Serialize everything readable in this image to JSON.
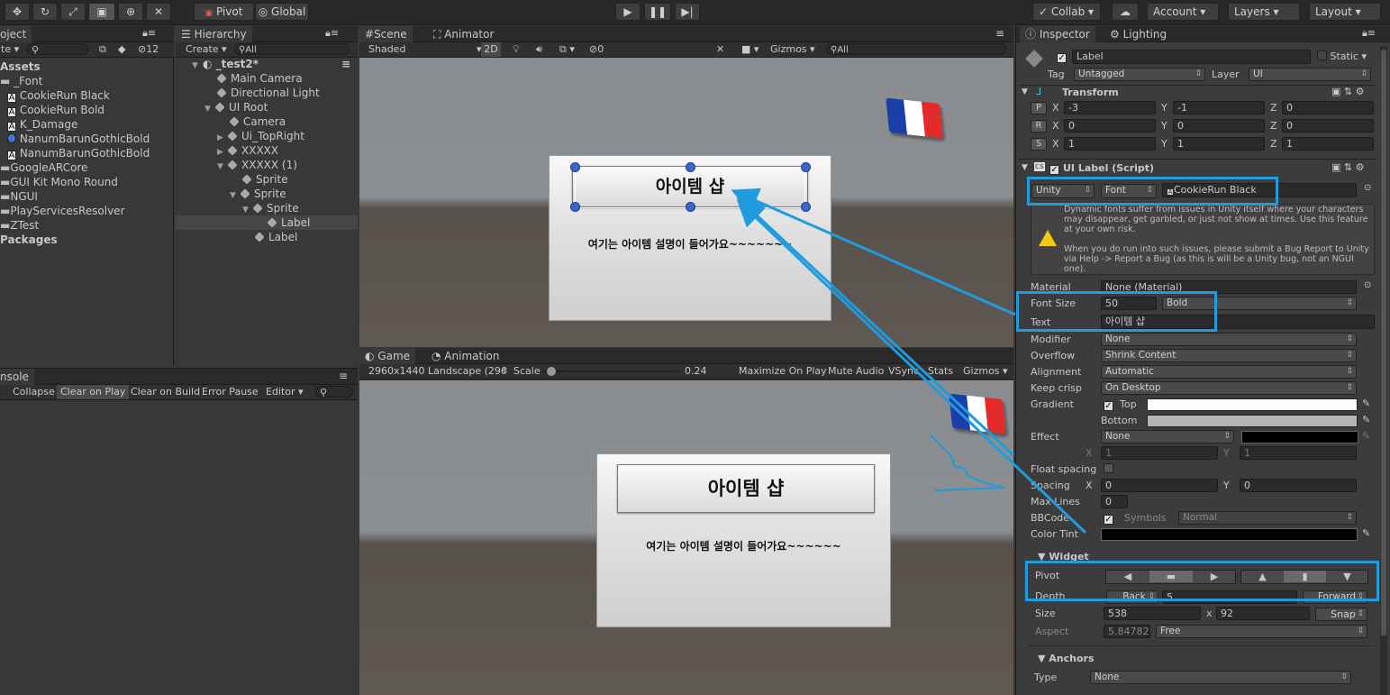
{
  "toolbar": {
    "pivot": "Pivot",
    "global": "Global",
    "collab": "Collab",
    "account": "Account",
    "layers": "Layers",
    "layout": "Layout"
  },
  "project": {
    "tab": "oject",
    "visible_count": "12",
    "assets": "Assets",
    "items": [
      "_Font",
      "CookieRun Black",
      "CookieRun Bold",
      "K_Damage",
      "NanumBarunGothicBold",
      "NanumBarunGothicBold",
      "GoogleARCore",
      "GUI Kit Mono Round",
      "NGUI",
      "PlayServicesResolver",
      "ZTest"
    ],
    "packages": "Packages"
  },
  "hierarchy": {
    "tab": "Hierarchy",
    "create": "Create",
    "search_placeholder": "All",
    "scene": "_test2*",
    "items": [
      "Main Camera",
      "Directional Light",
      "UI Root",
      "Camera",
      "Ui_TopRight",
      "XXXXX",
      "XXXXX (1)",
      "Sprite",
      "Sprite",
      "Sprite",
      "Label",
      "Label"
    ]
  },
  "console": {
    "tab": "nsole",
    "collapse": "Collapse",
    "clear_on_play": "Clear on Play",
    "clear_on_build": "Clear on Build",
    "error_pause": "Error Pause",
    "editor": "Editor"
  },
  "scene": {
    "tab": "Scene",
    "tab2": "Animator",
    "shaded": "Shaded",
    "mode2d": "2D",
    "fx_count": "0",
    "gizmos": "Gizmos",
    "search_placeholder": "All",
    "button_text": "아이템 샵",
    "desc_text": "여기는 아이템 설명이 들어가요~~~~~~~"
  },
  "game": {
    "tab": "Game",
    "tab2": "Animation",
    "resolution": "2960x1440 Landscape (296",
    "scale_label": "Scale",
    "scale_value": "0.24",
    "scale_fraction": 0.02,
    "maximize": "Maximize On Play",
    "mute": "Mute Audio",
    "vsync": "VSync",
    "stats": "Stats",
    "gizmos": "Gizmos",
    "button_text": "아이템 샵",
    "desc_text": "여기는 아이템 설명이 들어가요~~~~~~"
  },
  "inspector": {
    "tab": "Inspector",
    "tab2": "Lighting",
    "name": "Label",
    "static": "Static",
    "tag_label": "Tag",
    "tag": "Untagged",
    "layer_label": "Layer",
    "layer": "UI",
    "transform": {
      "title": "Transform",
      "p": {
        "x": "-3",
        "y": "-1",
        "z": "0"
      },
      "r": {
        "x": "0",
        "y": "0",
        "z": "0"
      },
      "s": {
        "x": "1",
        "y": "1",
        "z": "1"
      }
    },
    "uilabel": {
      "title": "UI Label (Script)",
      "font_type": "Unity",
      "font_btn": "Font",
      "font_name": "CookieRun Black",
      "warning1": "Dynamic fonts suffer from issues in Unity itself where your characters may disappear, get garbled, or just not show at times. Use this feature at your own risk.",
      "warning2": "When you do run into such issues, please submit a Bug Report to Unity via Help -> Report a Bug (as this is will be a Unity bug, not an NGUI one).",
      "material_label": "Material",
      "material": "None (Material)",
      "font_size_label": "Font Size",
      "font_size": "50",
      "font_style": "Bold",
      "text_label": "Text",
      "text": "아이템 샵",
      "modifier_label": "Modifier",
      "modifier": "None",
      "overflow_label": "Overflow",
      "overflow": "Shrink Content",
      "alignment_label": "Alignment",
      "alignment": "Automatic",
      "keep_crisp_label": "Keep crisp",
      "keep_crisp": "On Desktop",
      "gradient_label": "Gradient",
      "top_label": "Top",
      "bottom_label": "Bottom",
      "effect_label": "Effect",
      "effect": "None",
      "effect_x": "1",
      "effect_y": "1",
      "float_spacing_label": "Float spacing",
      "spacing_label": "Spacing",
      "spacing_x": "0",
      "spacing_y": "0",
      "max_lines_label": "Max Lines",
      "max_lines": "0",
      "bbcode_label": "BBCode",
      "symbols_label": "Symbols",
      "symbols": "Normal",
      "color_tint_label": "Color Tint"
    },
    "widget": {
      "title": "Widget",
      "pivot_label": "Pivot",
      "depth_label": "Depth",
      "back": "Back",
      "depth": "5",
      "forward": "Forward",
      "size_label": "Size",
      "width": "538",
      "x_sep": "x",
      "height": "92",
      "snap": "Snap",
      "aspect_label": "Aspect",
      "aspect": "5.84782",
      "aspect_mode": "Free"
    },
    "anchors": {
      "title": "Anchors",
      "type_label": "Type",
      "type": "None"
    }
  },
  "colors": {
    "highlight": "#1f9bde",
    "flag_blue": "#1b3fa8",
    "flag_white": "#ffffff",
    "flag_red": "#e32b2b"
  }
}
